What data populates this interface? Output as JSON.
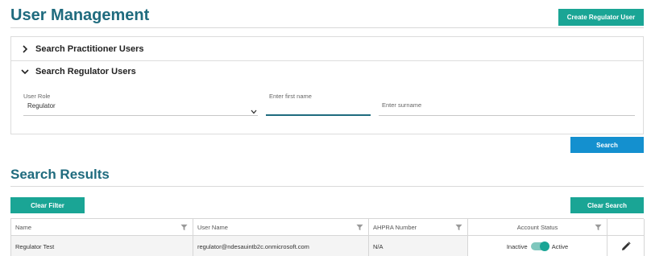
{
  "page": {
    "title": "User Management",
    "create_button": "Create Regulator User"
  },
  "accordion": {
    "practitioner_label": "Search Practitioner Users",
    "regulator_label": "Search Regulator Users"
  },
  "form": {
    "user_role": {
      "label": "User Role",
      "value": "Regulator"
    },
    "first_name": {
      "placeholder": "Enter first name",
      "value": ""
    },
    "surname": {
      "placeholder": "Enter surname",
      "value": ""
    },
    "search_button": "Search"
  },
  "results": {
    "title": "Search Results",
    "clear_filter_button": "Clear Filter",
    "clear_search_button": "Clear Search",
    "columns": [
      "Name",
      "User Name",
      "AHPRA Number",
      "Account Status",
      ""
    ],
    "rows": [
      {
        "name": "Regulator Test",
        "user_name": "regulator@ndesauintb2c.onmicrosoft.com",
        "ahpra": "N/A",
        "status_inactive_label": "Inactive",
        "status_active_label": "Active",
        "active": true
      }
    ]
  },
  "icons": [
    "chevron-right-icon",
    "chevron-down-icon",
    "filter-icon",
    "edit-pencil-icon"
  ],
  "colors": {
    "heading": "#1f6b7e",
    "teal": "#1aa595",
    "blue": "#1490cf"
  }
}
